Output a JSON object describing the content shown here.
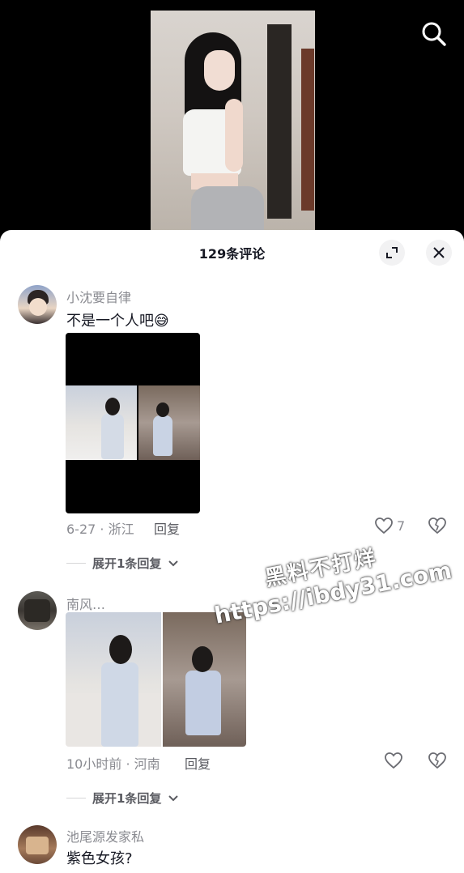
{
  "sheet": {
    "title": "129条评论"
  },
  "icons": {
    "search": "search-icon",
    "collapse": "collapse-icon",
    "close": "close-icon",
    "heart": "heart-icon",
    "dislike": "broken-heart-icon",
    "chevron": "chevron-down-icon"
  },
  "comments": [
    {
      "username": "小沈要自律",
      "text": "不是一个人吧😅",
      "meta": "6-27 · 浙江",
      "reply_label": "回复",
      "like_count": "7",
      "expand_label": "展开1条回复"
    },
    {
      "username": "南风…",
      "text": "",
      "meta": "10小时前 · 河南",
      "reply_label": "回复",
      "like_count": "",
      "expand_label": "展开1条回复"
    },
    {
      "username": "池尾源发家私",
      "text": "紫色女孩?",
      "meta": "",
      "reply_label": "",
      "like_count": "",
      "expand_label": ""
    }
  ],
  "watermark": {
    "line1": "黑料不打烊",
    "line2": "https://ibdy31.com"
  },
  "colors": {
    "sheet_bg": "#ffffff",
    "text_primary": "#161823",
    "text_secondary": "#8a8b91",
    "button_bg": "#f2f2f3"
  }
}
